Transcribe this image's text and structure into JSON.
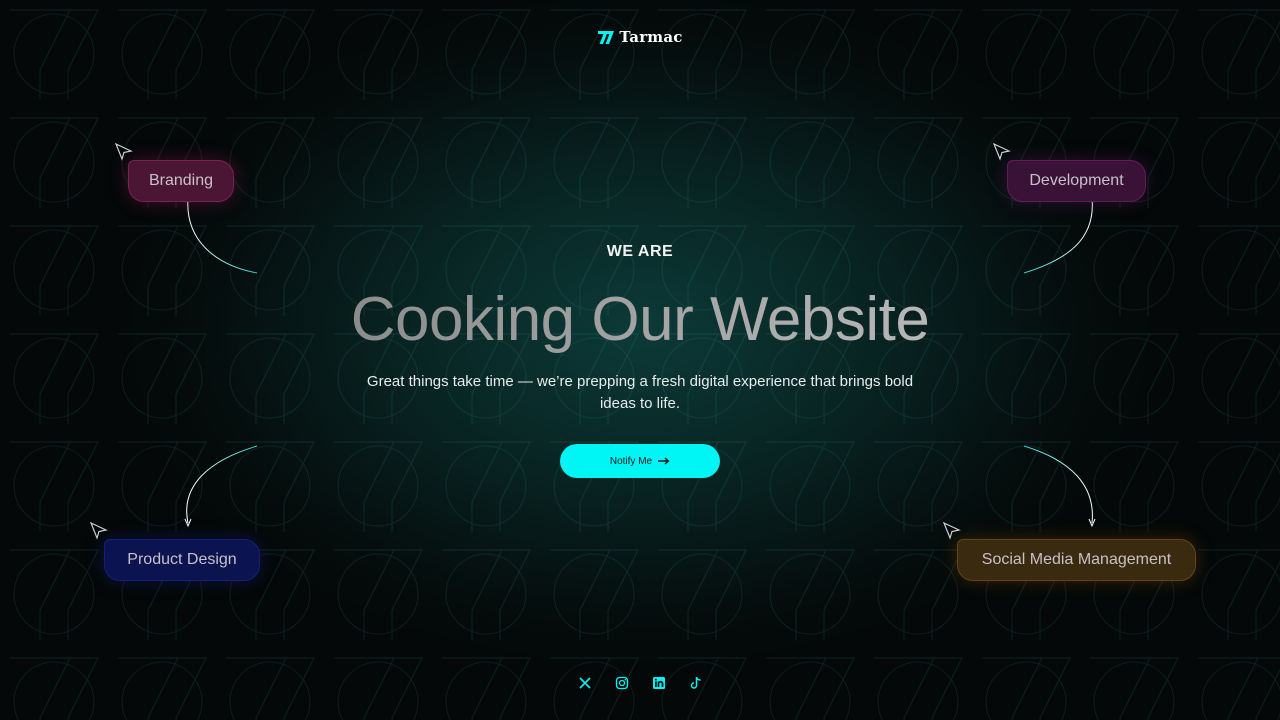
{
  "brand": {
    "name": "Tarmac",
    "accent": "#00f5f5"
  },
  "hero": {
    "eyebrow": "WE ARE",
    "headline": "Cooking Our Website",
    "subtitle": "Great things take time — we’re prepping a fresh digital experience that brings bold ideas to life.",
    "cta_label": "Notify Me"
  },
  "tags": {
    "branding": "Branding",
    "development": "Development",
    "product_design": "Product Design",
    "social_media": "Social Media Management"
  },
  "social_icons": [
    "x-icon",
    "instagram-icon",
    "linkedin-icon",
    "tiktok-icon"
  ]
}
